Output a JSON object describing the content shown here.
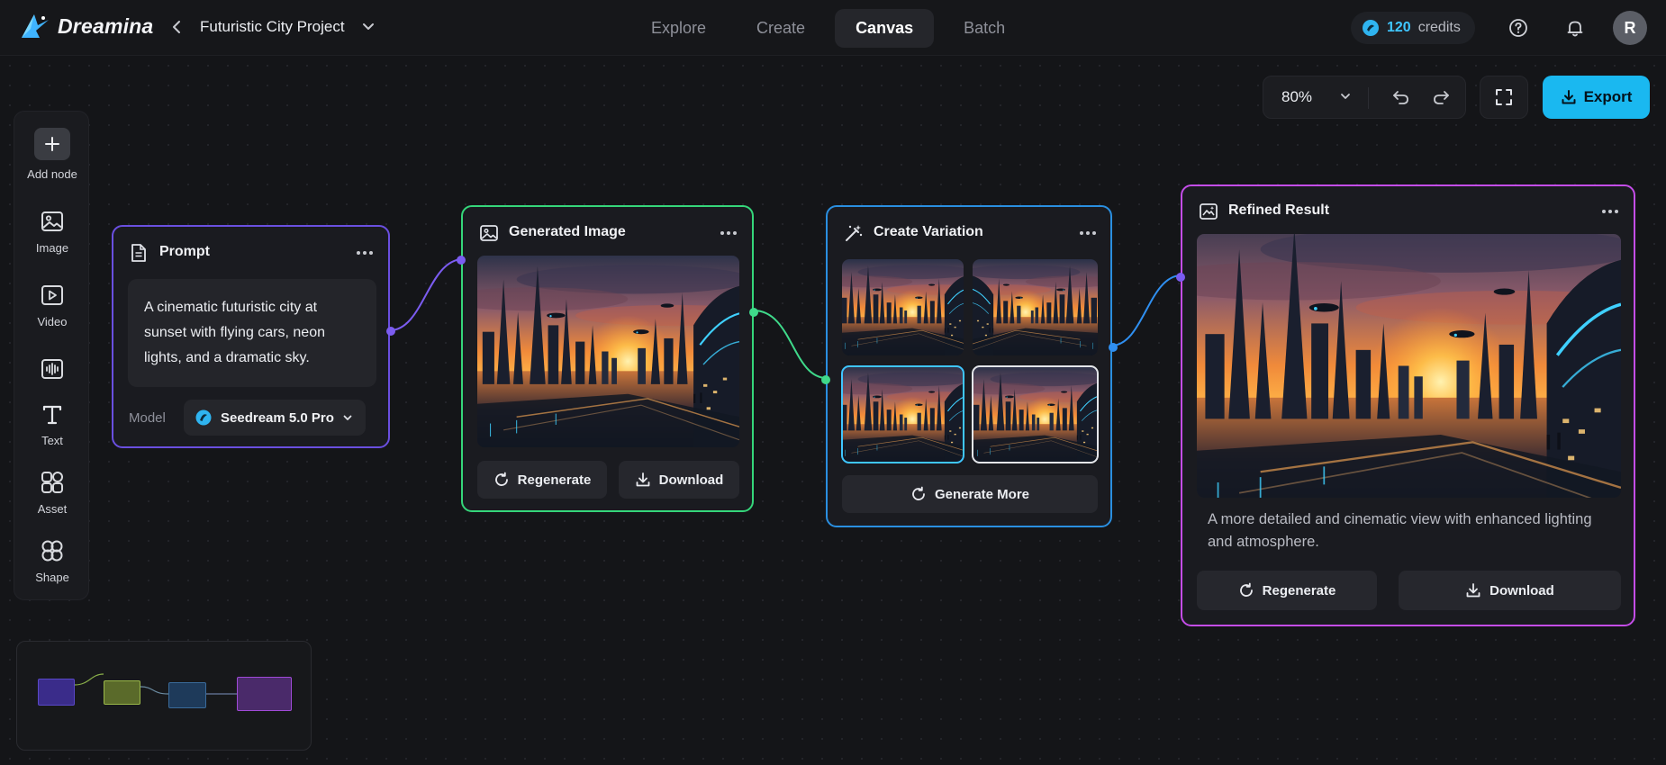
{
  "app": {
    "name": "Dreamina",
    "project_title": "Futuristic City Project"
  },
  "nav": {
    "tabs": [
      {
        "label": "Explore",
        "active": false
      },
      {
        "label": "Create",
        "active": false
      },
      {
        "label": "Canvas",
        "active": true
      },
      {
        "label": "Batch",
        "active": false
      }
    ]
  },
  "credits": {
    "amount": "120",
    "label": "credits"
  },
  "user": {
    "initial": "R"
  },
  "controls": {
    "zoom": "80%",
    "export_label": "Export"
  },
  "toolbar": {
    "items": [
      {
        "label": "Add node",
        "icon": "plus-icon"
      },
      {
        "label": "Image",
        "icon": "image-icon"
      },
      {
        "label": "Video",
        "icon": "video-icon"
      },
      {
        "label": "Audio",
        "icon": "audio-wave-icon"
      },
      {
        "label": "Text",
        "icon": "text-icon"
      },
      {
        "label": "Asset",
        "icon": "asset-icon"
      },
      {
        "label": "Shape",
        "icon": "shape-icon"
      }
    ]
  },
  "nodes": {
    "prompt": {
      "title": "Prompt",
      "text": "A cinematic futuristic city at sunset with flying cars, neon lights, and a dramatic sky.",
      "model_label": "Model",
      "model_value": "Seedream 5.0 Pro"
    },
    "generated": {
      "title": "Generated Image",
      "regenerate": "Regenerate",
      "download": "Download"
    },
    "variation": {
      "title": "Create Variation",
      "generate_more": "Generate More"
    },
    "refined": {
      "title": "Refined Result",
      "description": "A more detailed and cinematic view with enhanced lighting and atmosphere.",
      "regenerate": "Regenerate",
      "download": "Download"
    }
  },
  "colors": {
    "accent": "#1ab8f0",
    "prompt_border": "#6a4fe0",
    "generated_border": "#35d67a",
    "variation_border": "#2a8fe0",
    "refined_border": "#c44de8"
  }
}
